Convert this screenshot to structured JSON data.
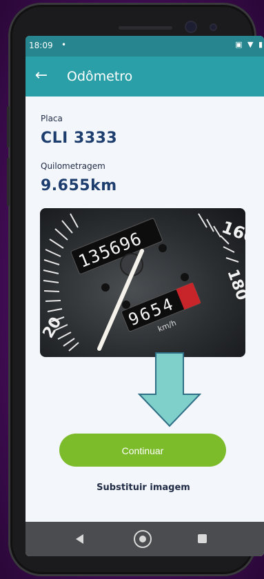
{
  "status_bar": {
    "time": "18:09",
    "dot": "•",
    "icons": "▣ ▼ ▮"
  },
  "app_bar": {
    "title": "Odômetro"
  },
  "vehicle": {
    "plate_label": "Placa",
    "plate_value": "CLI 3333",
    "mileage_label": "Quilometragem",
    "mileage_value": "9.655km"
  },
  "photo": {
    "odometer_digits": "135696",
    "trip_digits": "9654",
    "unit": "km/h",
    "speed_labels": [
      "20",
      "160",
      "180"
    ]
  },
  "actions": {
    "continue_label": "Continuar",
    "replace_label": "Substituir imagem"
  },
  "colors": {
    "appbar": "#2a9fa8",
    "statusbar": "#26858f",
    "primary_button": "#7cbc2a",
    "heading_text": "#1c3d6e",
    "arrow_fill": "#7fcfca",
    "arrow_stroke": "#2f6f86"
  },
  "icons": {
    "back": "arrow-left-icon",
    "nav_back": "triangle-back-icon",
    "nav_home": "circle-home-icon",
    "nav_recent": "square-recent-icon"
  }
}
